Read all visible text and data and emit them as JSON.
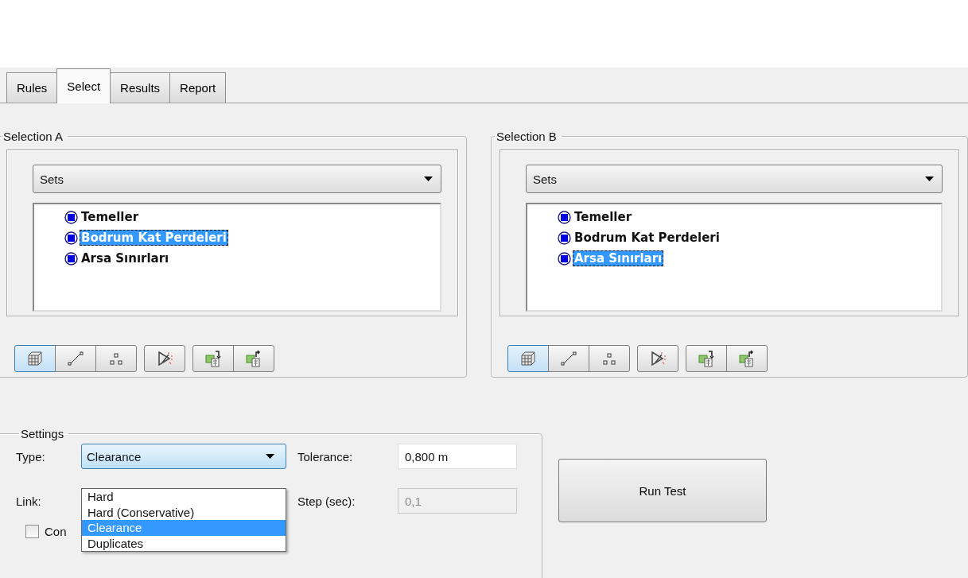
{
  "tabs": [
    {
      "label": "Rules",
      "selected": false
    },
    {
      "label": "Select",
      "selected": true
    },
    {
      "label": "Results",
      "selected": false
    },
    {
      "label": "Report",
      "selected": false
    }
  ],
  "selections": [
    {
      "title": "Selection A",
      "source": "Sets",
      "items": [
        {
          "label": "Temeller",
          "selected": false
        },
        {
          "label": "Bodrum Kat Perdeleri",
          "selected": true
        },
        {
          "label": "Arsa Sınırları",
          "selected": false
        }
      ],
      "tool_groups": [
        [
          {
            "kind": "geometry",
            "selected": true
          },
          {
            "kind": "line",
            "selected": false
          },
          {
            "kind": "points",
            "selected": false
          }
        ],
        [
          {
            "kind": "prune",
            "selected": false
          }
        ],
        [
          {
            "kind": "save",
            "selected": false
          },
          {
            "kind": "load",
            "selected": false
          }
        ]
      ]
    },
    {
      "title": "Selection B",
      "source": "Sets",
      "items": [
        {
          "label": "Temeller",
          "selected": false
        },
        {
          "label": "Bodrum Kat Perdeleri",
          "selected": false
        },
        {
          "label": "Arsa Sınırları",
          "selected": true
        }
      ],
      "tool_groups": [
        [
          {
            "kind": "geometry",
            "selected": true
          },
          {
            "kind": "line",
            "selected": false
          },
          {
            "kind": "points",
            "selected": false
          }
        ],
        [
          {
            "kind": "prune",
            "selected": false
          }
        ],
        [
          {
            "kind": "save",
            "selected": false
          },
          {
            "kind": "load",
            "selected": false
          }
        ]
      ]
    }
  ],
  "settings": {
    "title": "Settings",
    "type_label": "Type:",
    "type_value": "Clearance",
    "type_options": [
      {
        "label": "Hard",
        "selected": false
      },
      {
        "label": "Hard (Conservative)",
        "selected": false
      },
      {
        "label": "Clearance",
        "selected": true
      },
      {
        "label": "Duplicates",
        "selected": false
      }
    ],
    "tolerance_label": "Tolerance:",
    "tolerance_value": "0,800 m",
    "link_label": "Link:",
    "step_label": "Step (sec):",
    "step_value": "0,1",
    "step_disabled": true,
    "checkbox": {
      "label": "Con",
      "checked": false
    }
  },
  "run_button": "Run Test"
}
